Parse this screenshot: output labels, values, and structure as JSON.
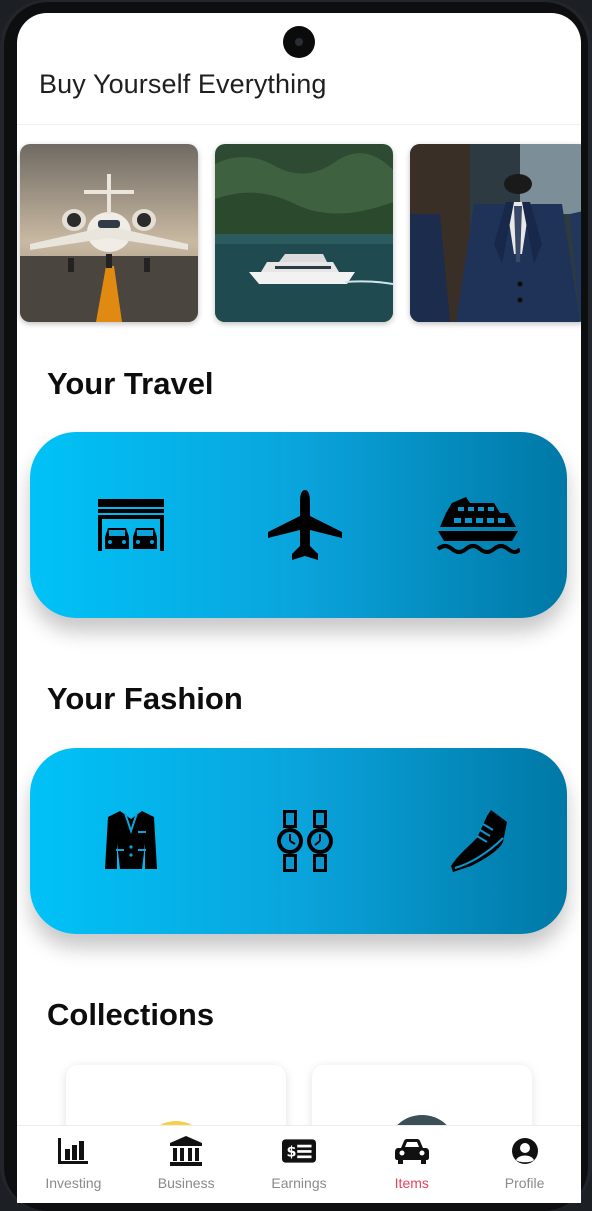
{
  "app_bar": {
    "title": "Buy Yourself Everything"
  },
  "carousel": {
    "items": [
      {
        "icon": "private-jet-photo"
      },
      {
        "icon": "yacht-photo"
      },
      {
        "icon": "suit-mannequin-photo"
      }
    ]
  },
  "travel": {
    "title": "Your Travel",
    "icons": [
      "garage-cars-icon",
      "airplane-icon",
      "cruise-ship-icon"
    ]
  },
  "fashion": {
    "title": "Your Fashion",
    "icons": [
      "blazer-icon",
      "watches-icon",
      "shoe-icon"
    ]
  },
  "collections": {
    "title": "Collections"
  },
  "nav": {
    "items": [
      {
        "label": "Investing",
        "icon": "bar-chart-icon",
        "active": false
      },
      {
        "label": "Business",
        "icon": "bank-icon",
        "active": false
      },
      {
        "label": "Earnings",
        "icon": "money-bill-icon",
        "active": false
      },
      {
        "label": "Items",
        "icon": "car-icon",
        "active": true
      },
      {
        "label": "Profile",
        "icon": "user-circle-icon",
        "active": false
      }
    ]
  },
  "colors": {
    "panel_gradient_start": "#00c2f7",
    "panel_gradient_end": "#0078a6",
    "active_nav": "#e8435d",
    "inactive_nav": "#8a8a8a"
  }
}
